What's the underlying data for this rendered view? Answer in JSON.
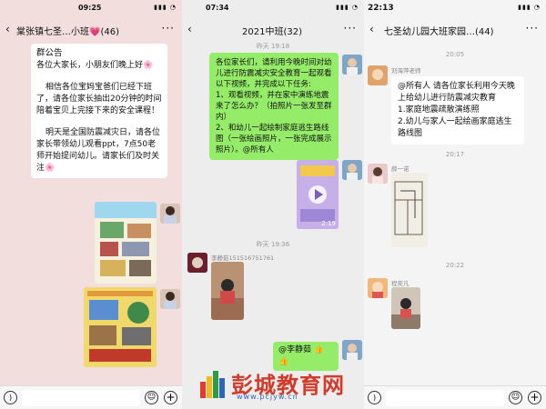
{
  "panel1": {
    "time": "09:25",
    "title": "棠张镇七圣…小班💗(46)",
    "notice_title": "群公告",
    "notice_greeting": "各位大家长，小朋友们晚上好🌸",
    "notice_p1": "相信各位宝妈宝爸们已经下班了，请各位家长抽出20分钟的时间陪着宝贝上完接下来的安全课程！",
    "notice_p2": "明天是全国防震减灾日，请各位家长带领幼儿观看ppt，7点50老师开始提问幼儿。请家长们及时关注🌸"
  },
  "panel2": {
    "time": "07:34",
    "title": "2021中班(32)",
    "stamp1": "昨天 19:18",
    "message": "各位家长们，请利用今晚时间对幼儿进行防震减灾安全教育一起观看以下视频，并完成以下任务:\n1、观看视频，并在家中演练地震来了怎么办？（拍照片一张发至群内）\n2、和幼儿一起绘制家庭逃生路线图（一张绘画照片，一张完成展示照片）。@所有人",
    "video_duration": "2:19",
    "stamp2": "昨天 19:36",
    "sender": "李静茹151516751761",
    "mention": "@李静茹 👍👍"
  },
  "panel3": {
    "time": "22:13",
    "title": "七圣幼儿园大班家园…(44)",
    "stamp1": "20:05",
    "teacher": "刘海萍老师",
    "message": "@所有人 请各位家长利用今天晚上给幼儿进行防震减灾教育\n1.家庭地震疏散演练照\n2.幼儿与家人一起绘画家庭逃生路线图",
    "stamp2": "20:17",
    "sender2": "薛一诺",
    "stamp3": "20:22",
    "sender3": "程奕凡"
  },
  "watermark": {
    "name": "彭城教育网",
    "url": "www.pcjyw.cn"
  },
  "colors": {
    "green_bubble": "#95ec69",
    "panel1_bg": "#f3dede",
    "watermark_red": "#d23a2a",
    "watermark_blue": "#2d66b8"
  }
}
